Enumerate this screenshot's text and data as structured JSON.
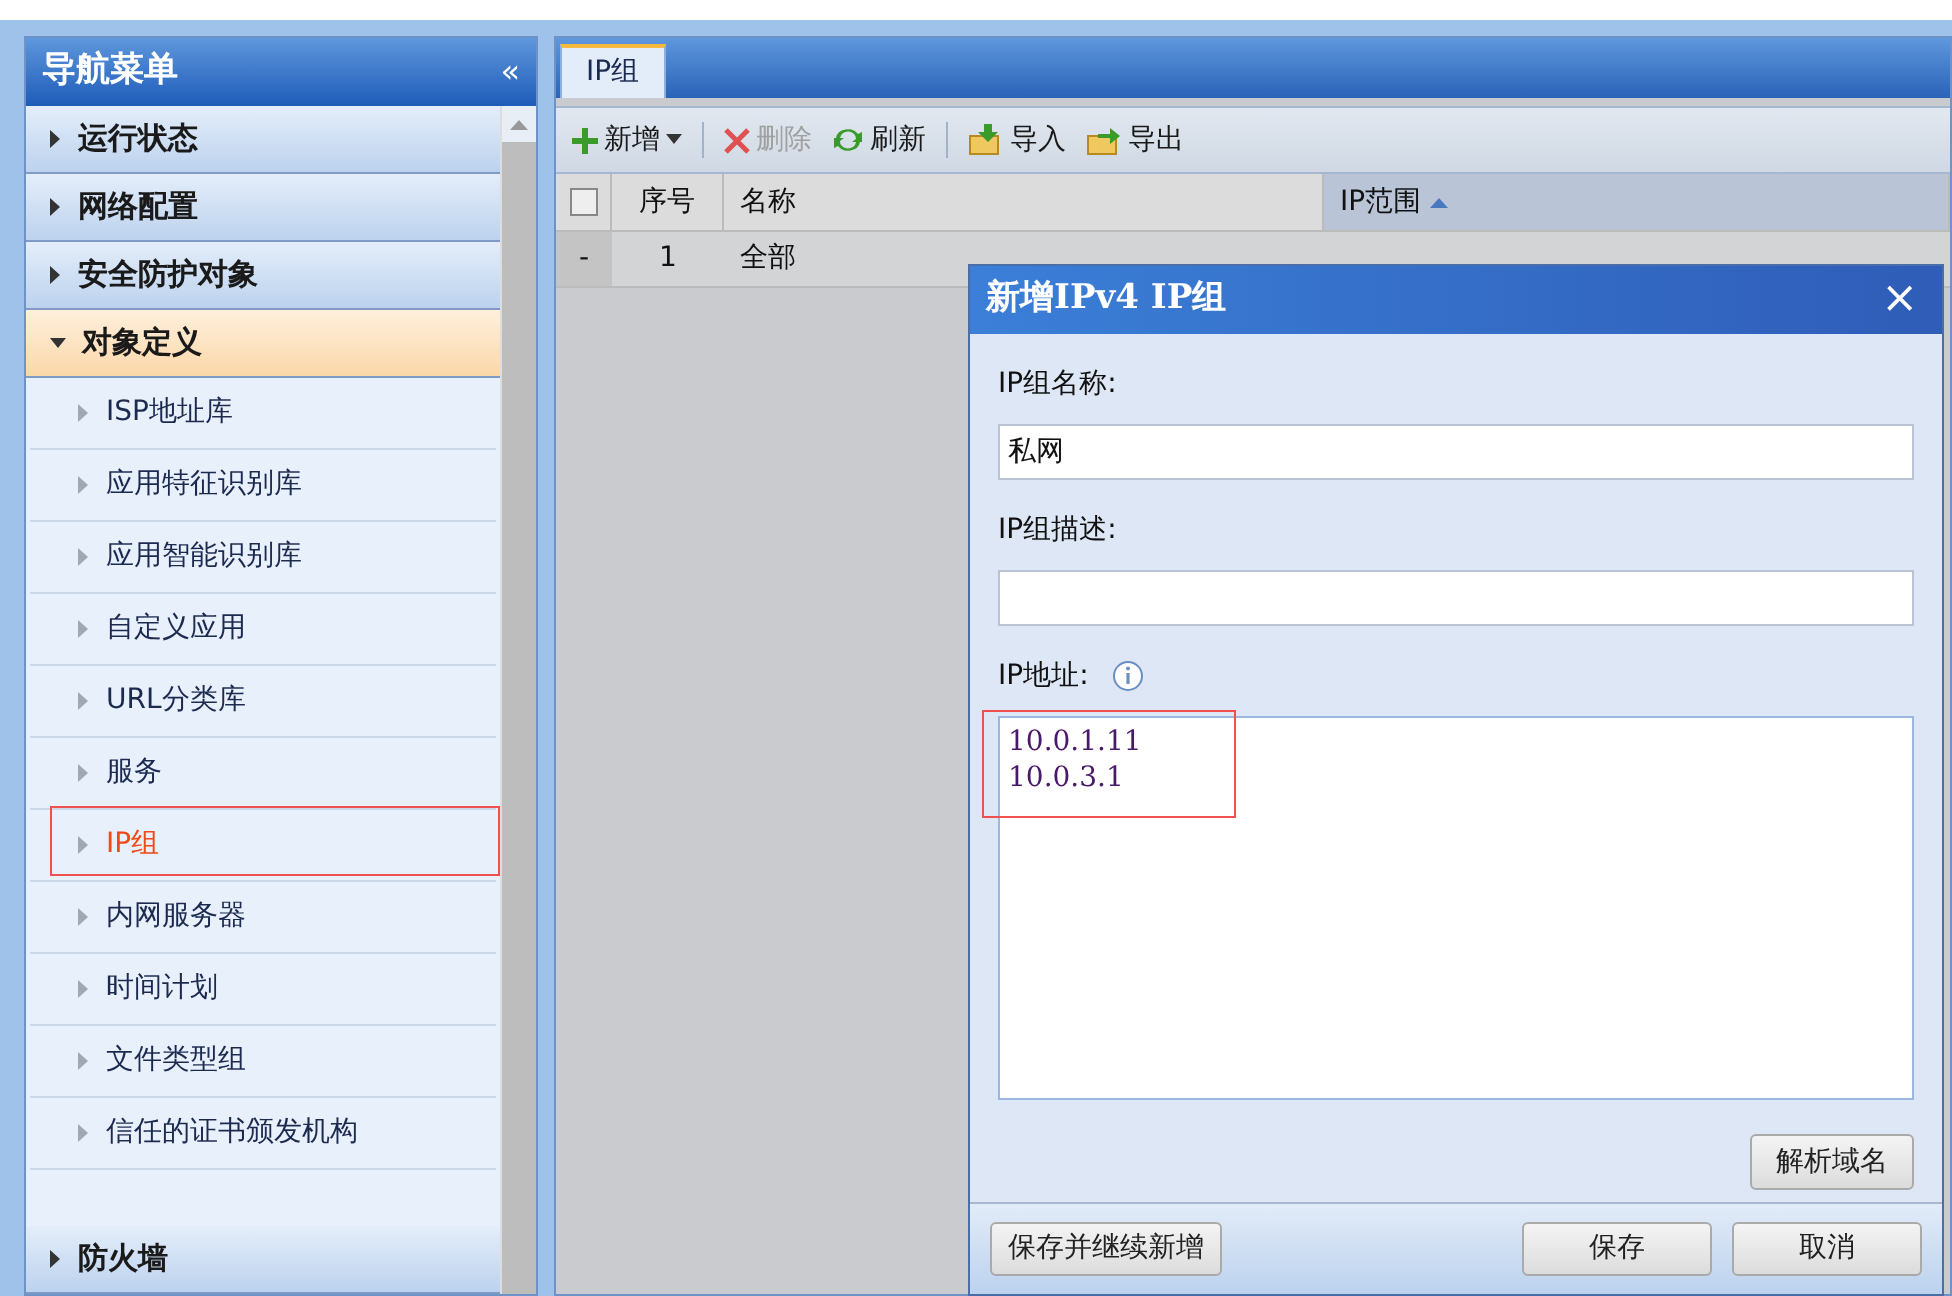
{
  "sidebar": {
    "title": "导航菜单",
    "collapse_glyph": "«",
    "sections": [
      {
        "label": "运行状态",
        "expanded": false
      },
      {
        "label": "网络配置",
        "expanded": false
      },
      {
        "label": "安全防护对象",
        "expanded": false
      },
      {
        "label": "对象定义",
        "expanded": true,
        "children": [
          {
            "label": "ISP地址库",
            "selected": false,
            "highlighted": false
          },
          {
            "label": "应用特征识别库",
            "selected": false,
            "highlighted": false
          },
          {
            "label": "应用智能识别库",
            "selected": false,
            "highlighted": false
          },
          {
            "label": "自定义应用",
            "selected": false,
            "highlighted": false
          },
          {
            "label": "URL分类库",
            "selected": false,
            "highlighted": false
          },
          {
            "label": "服务",
            "selected": false,
            "highlighted": false
          },
          {
            "label": "IP组",
            "selected": true,
            "highlighted": true
          },
          {
            "label": "内网服务器",
            "selected": false,
            "highlighted": false
          },
          {
            "label": "时间计划",
            "selected": false,
            "highlighted": false
          },
          {
            "label": "文件类型组",
            "selected": false,
            "highlighted": false
          },
          {
            "label": "信任的证书颁发机构",
            "selected": false,
            "highlighted": false
          }
        ]
      },
      {
        "label": "防火墙",
        "expanded": false
      }
    ]
  },
  "tabs": [
    {
      "label": "IP组",
      "selected": true
    }
  ],
  "toolbar": [
    {
      "kind": "add",
      "label": "新增",
      "disabled": false,
      "dropdown": true
    },
    {
      "kind": "delete",
      "label": "删除",
      "disabled": true,
      "dropdown": false
    },
    {
      "kind": "refresh",
      "label": "刷新",
      "disabled": false,
      "dropdown": false
    },
    {
      "kind": "import",
      "label": "导入",
      "disabled": false,
      "dropdown": false
    },
    {
      "kind": "export",
      "label": "导出",
      "disabled": false,
      "dropdown": false
    }
  ],
  "table": {
    "select_all_checked": false,
    "columns": [
      {
        "label": "序号",
        "sorted": false
      },
      {
        "label": "名称",
        "sorted": false
      },
      {
        "label": "IP范围",
        "sorted": true
      }
    ],
    "rows": [
      {
        "marker": "-",
        "cells": [
          "1",
          "全部"
        ]
      }
    ]
  },
  "dialog": {
    "title": "新增IPv4 IP组",
    "close_glyph": "×",
    "fields": [
      {
        "kind": "input",
        "label": "IP组名称:",
        "value": "私网"
      },
      {
        "kind": "input",
        "label": "IP组描述:"
      },
      {
        "kind": "textarea",
        "label": "IP地址:",
        "info": true,
        "value": "10.0.1.11\n10.0.3.1",
        "highlighted": true
      }
    ],
    "resolve_button": "解析域名",
    "footer_buttons": [
      "保存并继续新增",
      "保存",
      "取消"
    ]
  }
}
